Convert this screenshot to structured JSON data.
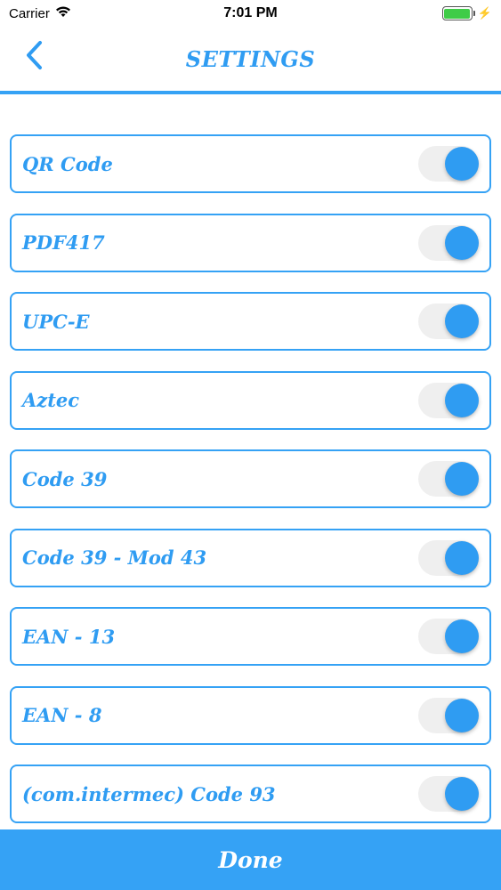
{
  "status_bar": {
    "carrier": "Carrier",
    "time": "7:01 PM",
    "battery_level": 1.0,
    "charging": true
  },
  "nav": {
    "title": "SETTINGS",
    "back_icon": "chevron-left-icon"
  },
  "settings": [
    {
      "label": "QR Code",
      "enabled": true
    },
    {
      "label": "PDF417",
      "enabled": true
    },
    {
      "label": "UPC-E",
      "enabled": true
    },
    {
      "label": "Aztec",
      "enabled": true
    },
    {
      "label": "Code 39",
      "enabled": true
    },
    {
      "label": "Code 39 - Mod 43",
      "enabled": true
    },
    {
      "label": "EAN - 13",
      "enabled": true
    },
    {
      "label": "EAN - 8",
      "enabled": true
    },
    {
      "label": "(com.intermec) Code 93",
      "enabled": true
    }
  ],
  "footer": {
    "done_label": "Done"
  },
  "colors": {
    "accent": "#35a2f5",
    "text": "#2f9cf2",
    "toggle_track": "#efefef"
  }
}
